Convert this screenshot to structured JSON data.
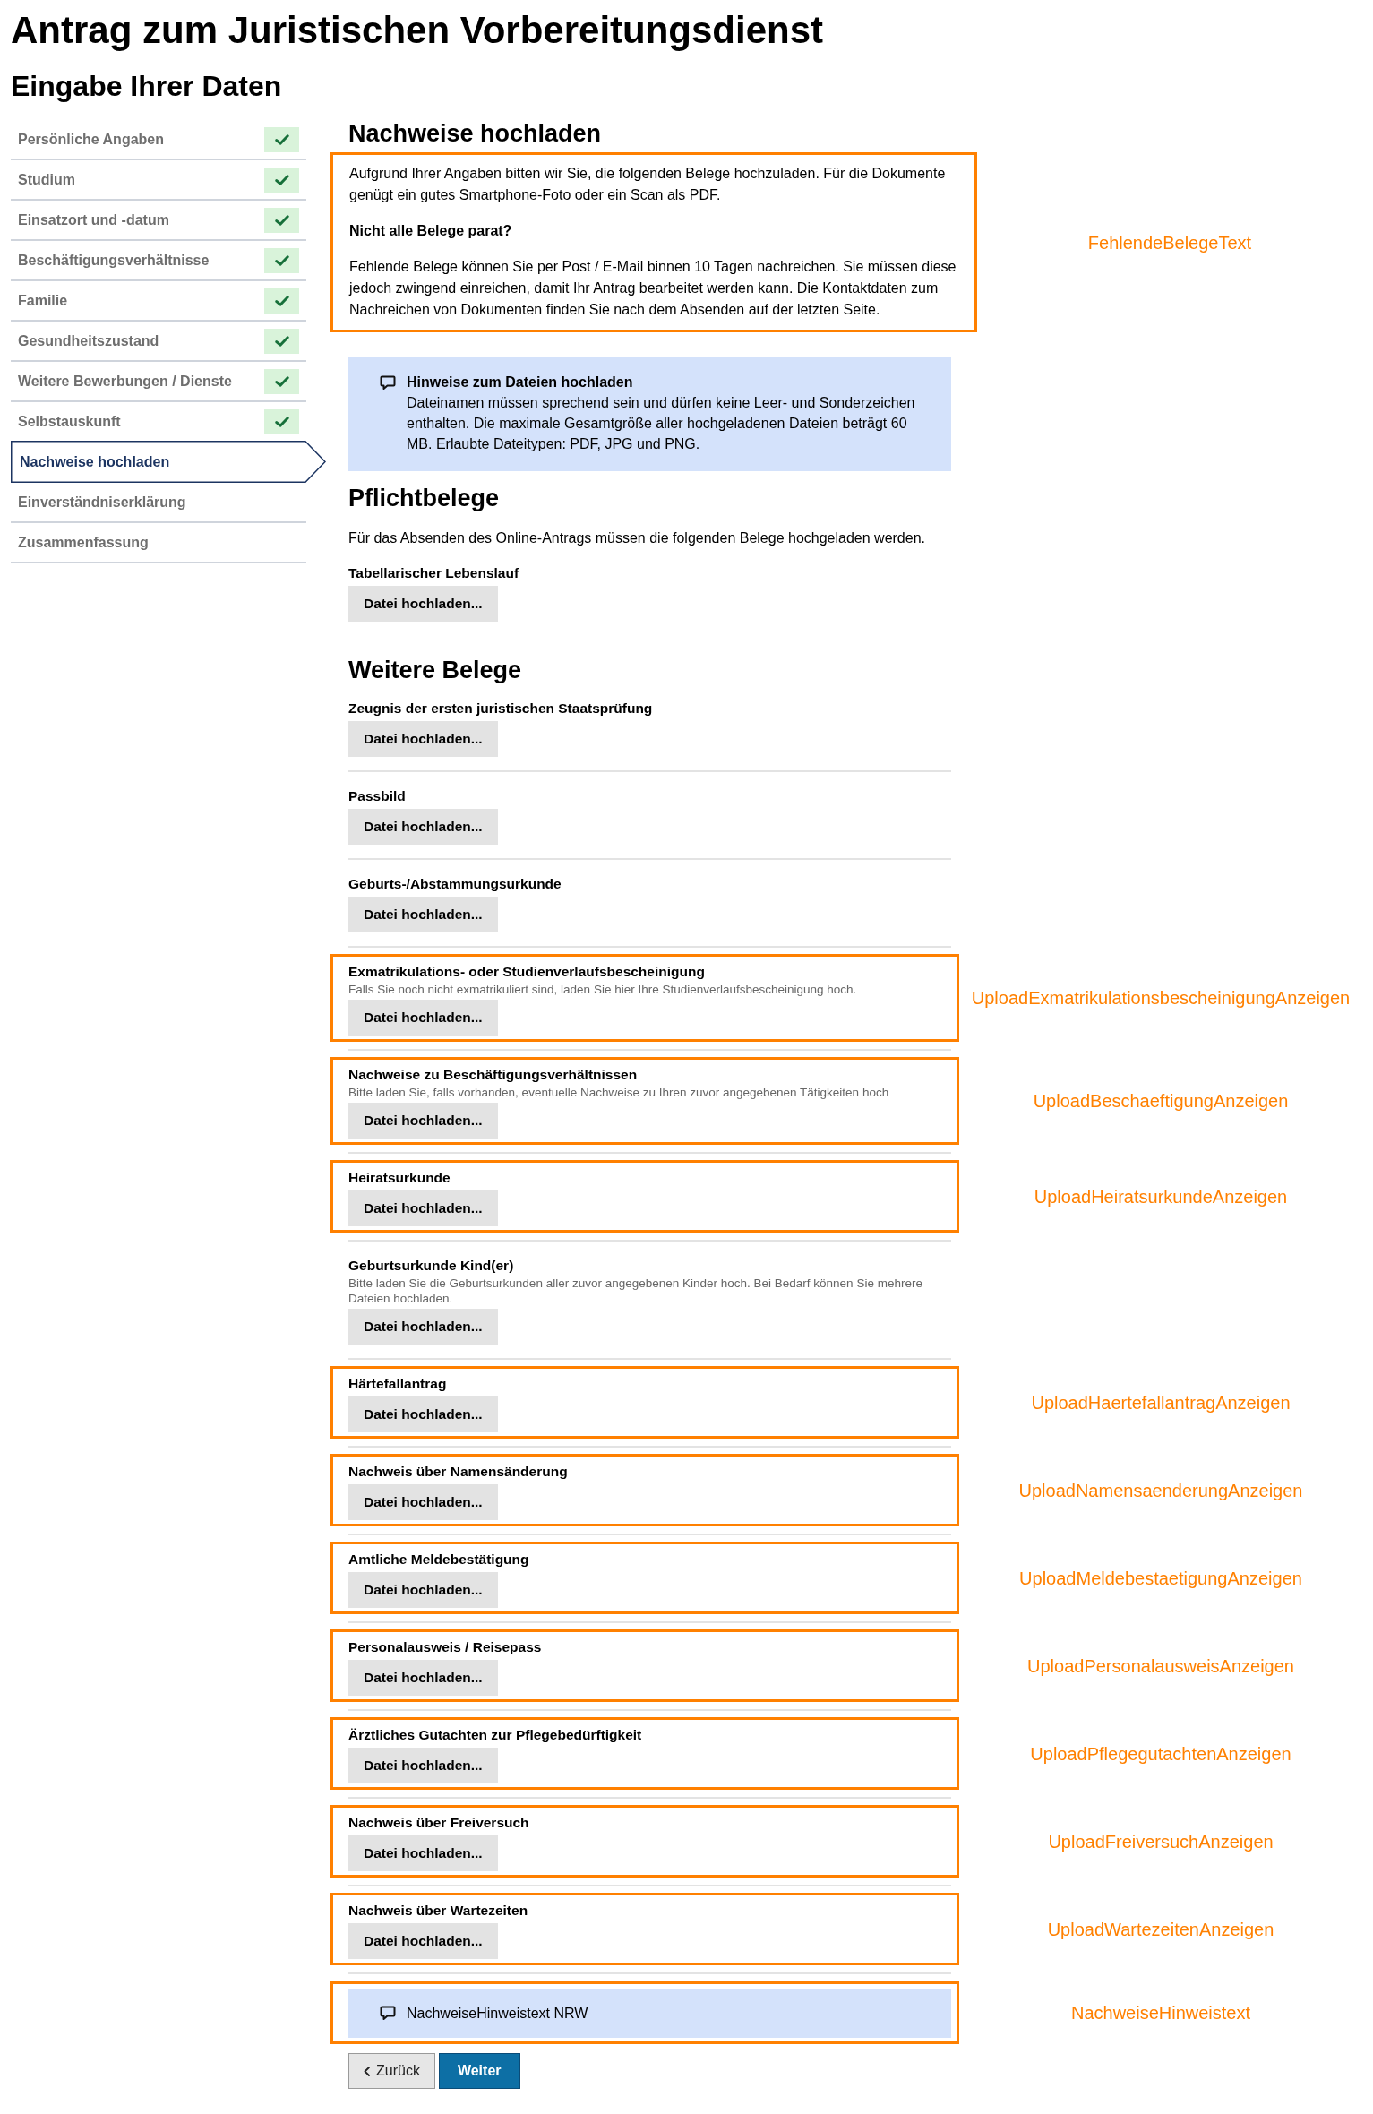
{
  "page": {
    "title": "Antrag zum Juristischen Vorbereitungsdienst",
    "subtitle": "Eingabe Ihrer Daten"
  },
  "sidebar": {
    "items": [
      {
        "label": "Persönliche Angaben",
        "selected": false,
        "completed": true
      },
      {
        "label": "Studium",
        "selected": false,
        "completed": true
      },
      {
        "label": "Einsatzort und -datum",
        "selected": false,
        "completed": true
      },
      {
        "label": "Beschäftigungsverhältnisse",
        "selected": false,
        "completed": true
      },
      {
        "label": "Familie",
        "selected": false,
        "completed": true
      },
      {
        "label": "Gesundheitszustand",
        "selected": false,
        "completed": true
      },
      {
        "label": "Weitere Bewerbungen / Dienste",
        "selected": false,
        "completed": true
      },
      {
        "label": "Selbstauskunft",
        "selected": false,
        "completed": true
      },
      {
        "label": "Nachweise hochladen",
        "selected": true,
        "completed": false
      },
      {
        "label": "Einverständniserklärung",
        "selected": false,
        "completed": false
      },
      {
        "label": "Zusammenfassung",
        "selected": false,
        "completed": false
      }
    ]
  },
  "main": {
    "heading": "Nachweise hochladen",
    "intro": {
      "annotation": "FehlendeBelegeText",
      "paragraphs": [
        {
          "kind": "text",
          "text": "Aufgrund Ihrer Angaben bitten wir Sie, die folgenden Belege hochzuladen. Für die Dokumente genügt ein gutes Smartphone-Foto oder ein Scan als PDF."
        },
        {
          "kind": "subheading",
          "text": "Nicht alle Belege parat?"
        },
        {
          "kind": "text",
          "text": "Fehlende Belege können Sie per Post / E-Mail binnen 10 Tagen nachreichen. Sie müssen diese jedoch zwingend einreichen, damit Ihr Antrag bearbeitet werden kann. Die Kontaktdaten zum Nachreichen von Dokumenten finden Sie nach dem Absenden auf der letzten Seite."
        }
      ]
    },
    "upload_notice": {
      "title": "Hinweise zum Dateien hochladen",
      "text": "Dateinamen müssen sprechend sein und dürfen keine Leer- und Sonderzeichen enthalten. Die maximale Gesamtgröße aller hochgeladenen Dateien beträgt 60 MB. Erlaubte Dateitypen: PDF, JPG und PNG."
    },
    "required": {
      "heading": "Pflichtbelege",
      "text": "Für das Absenden des Online-Antrags müssen die folgenden Belege hochgeladen werden.",
      "items": [
        {
          "label": "Tabellarischer Lebenslauf",
          "button": "Datei hochladen..."
        }
      ]
    },
    "additional": {
      "heading": "Weitere Belege",
      "items": [
        {
          "label": "Zeugnis der ersten juristischen Staatsprüfung",
          "button": "Datei hochladen..."
        },
        {
          "label": "Passbild",
          "button": "Datei hochladen..."
        },
        {
          "label": "Geburts-/Abstammungsurkunde",
          "button": "Datei hochladen..."
        },
        {
          "label": "Exmatrikulations- oder Studienverlaufsbescheinigung",
          "hint": "Falls Sie noch nicht exmatrikuliert sind, laden Sie hier Ihre Studienverlaufsbescheinigung hoch.",
          "button": "Datei hochladen...",
          "annotation": "UploadExmatrikulationsbescheinigungAnzeigen"
        },
        {
          "label": "Nachweise zu Beschäftigungsverhältnissen",
          "hint": "Bitte laden Sie, falls vorhanden, eventuelle Nachweise zu Ihren zuvor angegebenen Tätigkeiten hoch",
          "button": "Datei hochladen...",
          "annotation": "UploadBeschaeftigungAnzeigen"
        },
        {
          "label": "Heiratsurkunde",
          "button": "Datei hochladen...",
          "annotation": "UploadHeiratsurkundeAnzeigen"
        },
        {
          "label": "Geburtsurkunde Kind(er)",
          "hint": "Bitte laden Sie die Geburtsurkunden aller zuvor angegebenen Kinder hoch. Bei Bedarf können Sie mehrere Dateien hochladen.",
          "button": "Datei hochladen..."
        },
        {
          "label": "Härtefallantrag",
          "button": "Datei hochladen...",
          "annotation": "UploadHaertefallantragAnzeigen"
        },
        {
          "label": "Nachweis über Namensänderung",
          "button": "Datei hochladen...",
          "annotation": "UploadNamensaenderungAnzeigen"
        },
        {
          "label": "Amtliche Meldebestätigung",
          "button": "Datei hochladen...",
          "annotation": "UploadMeldebestaetigungAnzeigen"
        },
        {
          "label": "Personalausweis / Reisepass",
          "button": "Datei hochladen...",
          "annotation": "UploadPersonalausweisAnzeigen"
        },
        {
          "label": "Ärztliches Gutachten zur Pflegebedürftigkeit",
          "button": "Datei hochladen...",
          "annotation": "UploadPflegegutachtenAnzeigen"
        },
        {
          "label": "Nachweis über Freiversuch",
          "button": "Datei hochladen...",
          "annotation": "UploadFreiversuchAnzeigen"
        },
        {
          "label": "Nachweis über Wartezeiten",
          "button": "Datei hochladen...",
          "annotation": "UploadWartezeitenAnzeigen"
        }
      ]
    },
    "footer_notice": {
      "text": "NachweiseHinweistext NRW",
      "annotation": "NachweiseHinweistext"
    },
    "buttons": [
      {
        "kind": "back",
        "label": "Zurück"
      },
      {
        "kind": "primary",
        "label": "Weiter"
      }
    ]
  }
}
